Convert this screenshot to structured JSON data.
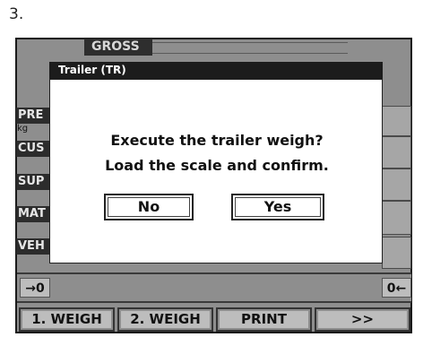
{
  "step_label": "3.",
  "header": {
    "gross_label": "GROSS"
  },
  "left_labels": [
    {
      "label": "PRE"
    },
    {
      "label": "CUS"
    },
    {
      "label": "SUP"
    },
    {
      "label": "MAT"
    },
    {
      "label": "VEH"
    }
  ],
  "unit_label": "kg",
  "arrows": {
    "left": "→0",
    "right": "0←"
  },
  "function_keys": [
    "1. WEIGH",
    "2. WEIGH",
    "PRINT",
    ">>"
  ],
  "dialog": {
    "title": "Trailer (TR)",
    "message_line1": "Execute the trailer weigh?",
    "message_line2": "Load the scale and confirm.",
    "no_label": "No",
    "yes_label": "Yes"
  }
}
